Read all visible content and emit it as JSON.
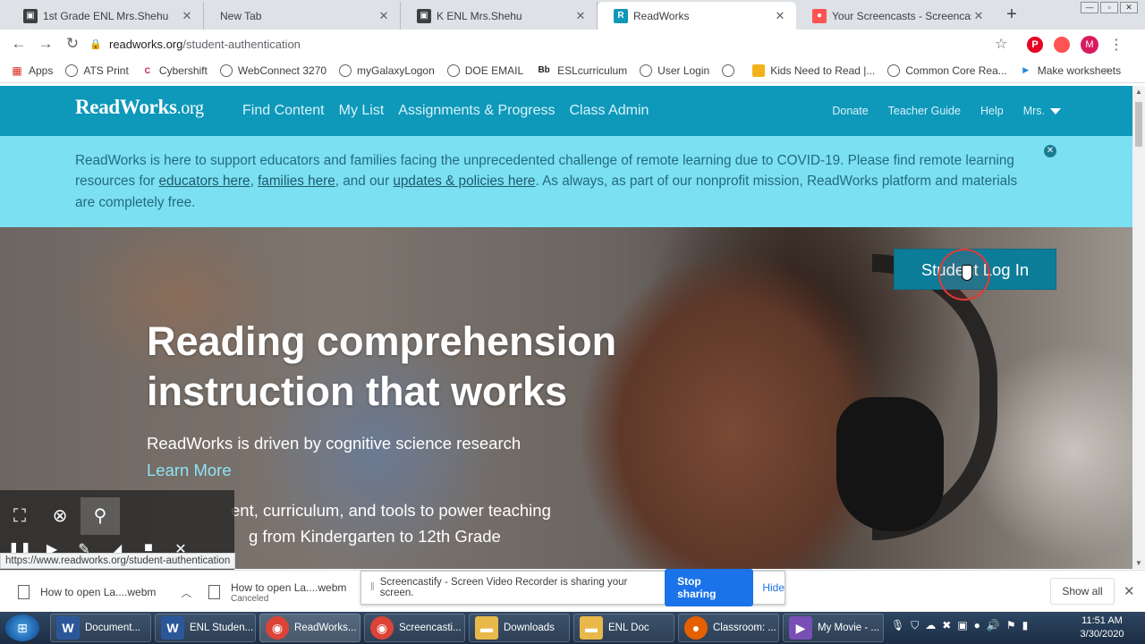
{
  "tabs": [
    {
      "title": "1st Grade ENL Mrs.Shehu",
      "icon": "classroom-icon"
    },
    {
      "title": "New Tab",
      "icon": ""
    },
    {
      "title": "K ENL Mrs.Shehu",
      "icon": "classroom-icon"
    },
    {
      "title": "ReadWorks",
      "icon": "readworks-icon",
      "active": true
    },
    {
      "title": "Your Screencasts - Screencastify",
      "icon": "screencastify-icon"
    }
  ],
  "address": {
    "host": "readworks.org",
    "path": "/student-authentication"
  },
  "profile_initial": "M",
  "bookmarks": [
    "Apps",
    "ATS Print",
    "Cybershift",
    "WebConnect 3270",
    "myGalaxyLogon",
    "DOE EMAIL",
    "ESLcurriculum",
    "User Login",
    "",
    "Kids Need to Read |...",
    "Common Core Rea...",
    "Make worksheets"
  ],
  "site_nav": {
    "logo": "ReadWorks",
    "logo_suffix": ".org",
    "links": [
      "Find Content",
      "My List",
      "Assignments & Progress",
      "Class Admin"
    ],
    "right_links": [
      "Donate",
      "Teacher Guide",
      "Help",
      "Mrs."
    ]
  },
  "banner": {
    "text_1": "ReadWorks is here to support educators and families facing the unprecedented challenge of remote learning due to COVID-19. Please find remote learning resources for ",
    "link_educators": "educators here",
    "sep_1": ", ",
    "link_families": "families here",
    "sep_2": ", and our ",
    "link_updates": "updates & policies here",
    "text_2": ". As always, as part of our nonprofit mission, ReadWorks platform and materials are completely free."
  },
  "hero": {
    "title_line1": "Reading comprehension",
    "title_line2": "instruction that works",
    "subtitle": "ReadWorks is driven by cognitive science research",
    "learn_more": "Learn More",
    "line1": "ent, curriculum, and tools to power teaching",
    "line2": "g from Kindergarten to 12th Grade",
    "student_login": "Student Log In"
  },
  "status_url": "https://www.readworks.org/student-authentication",
  "downloads": [
    {
      "name": "How to open La....webm",
      "status": ""
    },
    {
      "name": "How to open La....webm",
      "status": "Canceled"
    }
  ],
  "share_bar": {
    "message": "Screencastify - Screen Video Recorder is sharing your screen.",
    "stop": "Stop sharing",
    "hide": "Hide"
  },
  "show_all": "Show all",
  "taskbar": [
    {
      "label": "Document...",
      "icon": "word-icon",
      "color": "#2b579a"
    },
    {
      "label": "ENL Studen...",
      "icon": "word-icon",
      "color": "#2b579a"
    },
    {
      "label": "ReadWorks...",
      "icon": "chrome-icon",
      "color": "#db4437"
    },
    {
      "label": "Screencasti...",
      "icon": "chrome-icon",
      "color": "#db4437"
    },
    {
      "label": "Downloads",
      "icon": "folder-icon",
      "color": "#e8b84a"
    },
    {
      "label": "ENL Doc",
      "icon": "folder-icon",
      "color": "#e8b84a"
    },
    {
      "label": "Classroom: ...",
      "icon": "firefox-icon",
      "color": "#e66000"
    },
    {
      "label": "My Movie - ...",
      "icon": "movie-maker-icon",
      "color": "#7a4fb5"
    }
  ],
  "clock": {
    "time": "11:51 AM",
    "date": "3/30/2020"
  },
  "colors": {
    "brand": "#0e98ba",
    "banner": "#7ce0f3",
    "login_button": "#0c7d99"
  }
}
